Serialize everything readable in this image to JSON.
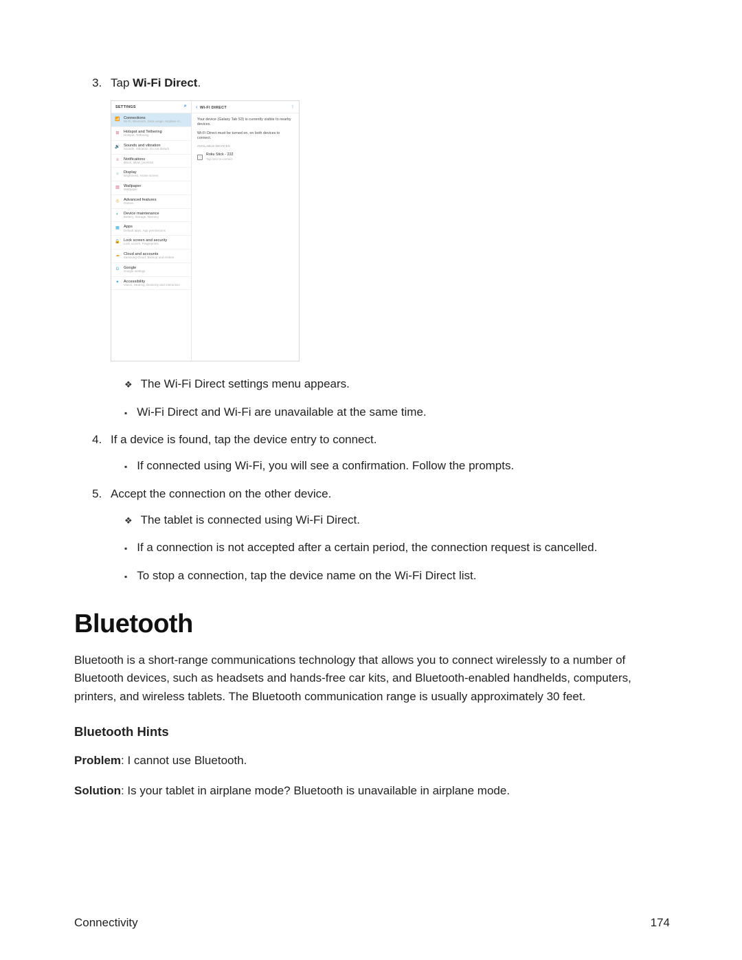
{
  "step3": {
    "prefix": "Tap ",
    "bold": "Wi-Fi Direct",
    "suffix": "."
  },
  "screenshot": {
    "left_title": "SETTINGS",
    "items": [
      {
        "t": "Connections",
        "s": "Wi-Fi, Bluetooth, Data usage, Airplane m…",
        "ic": "📶",
        "c": "#2a9fd8",
        "active": true
      },
      {
        "t": "Hotspot and Tethering",
        "s": "Hotspot, Tethering",
        "ic": "⊞",
        "c": "#d0637a"
      },
      {
        "t": "Sounds and vibration",
        "s": "Sounds, Vibration, Do not disturb",
        "ic": "🔊",
        "c": "#2a9fd8"
      },
      {
        "t": "Notifications",
        "s": "Block, allow, prioritize",
        "ic": "≡",
        "c": "#d0637a"
      },
      {
        "t": "Display",
        "s": "Brightness, Home screen",
        "ic": "☼",
        "c": "#3cb371"
      },
      {
        "t": "Wallpaper",
        "s": "Wallpaper",
        "ic": "▧",
        "c": "#d0637a"
      },
      {
        "t": "Advanced features",
        "s": "Games",
        "ic": "◎",
        "c": "#e8a43b"
      },
      {
        "t": "Device maintenance",
        "s": "Battery, Storage, Memory",
        "ic": "◐",
        "c": "#3cb371"
      },
      {
        "t": "Apps",
        "s": "Default apps, App permissions",
        "ic": "▦",
        "c": "#2a9fd8"
      },
      {
        "t": "Lock screen and security",
        "s": "Lock screen, Fingerprints",
        "ic": "🔒",
        "c": "#2a9fd8"
      },
      {
        "t": "Cloud and accounts",
        "s": "Samsung Cloud, Backup and restore",
        "ic": "☁",
        "c": "#e8a43b"
      },
      {
        "t": "Google",
        "s": "Google settings",
        "ic": "G",
        "c": "#2a9fd8"
      },
      {
        "t": "Accessibility",
        "s": "Vision, Hearing, Dexterity and interaction",
        "ic": "✦",
        "c": "#2a9fd8"
      }
    ],
    "right_title": "WI-FI DIRECT",
    "note1": "Your device (Galaxy Tab S3) is currently visible to nearby devices.",
    "note2": "Wi-Fi Direct must be turned on, on both devices to connect.",
    "section": "AVAILABLE DEVICES",
    "dev": {
      "t": "Roku Stick - 222",
      "s": "Tap here to connect"
    }
  },
  "step3_b1": "The Wi-Fi Direct settings menu appears.",
  "step3_b2": "Wi-Fi Direct and Wi-Fi are unavailable at the same time.",
  "step4": "If a device is found, tap the device entry to connect.",
  "step4_b1": "If connected using Wi-Fi, you will see a confirmation. Follow the prompts.",
  "step5": "Accept the connection on the other device.",
  "step5_b1": "The tablet is connected using Wi-Fi Direct.",
  "step5_b2": "If a connection is not accepted after a certain period, the connection request is cancelled.",
  "step5_b3": "To stop a connection, tap the device name on the Wi-Fi Direct list.",
  "bt_heading": "Bluetooth",
  "bt_para": "Bluetooth is a short-range communications technology that allows you to connect wirelessly to a number of Bluetooth devices, such as headsets and hands-free car kits, and Bluetooth-enabled handhelds, computers, printers, and wireless tablets. The Bluetooth communication range is usually approximately 30 feet.",
  "bh_heading": "Bluetooth Hints",
  "p_label": "Problem",
  "p_text": ": I cannot use Bluetooth.",
  "s_label": "Solution",
  "s_text": ": Is your tablet in airplane mode? Bluetooth is unavailable in airplane mode.",
  "footer_l": "Connectivity",
  "footer_r": "174"
}
